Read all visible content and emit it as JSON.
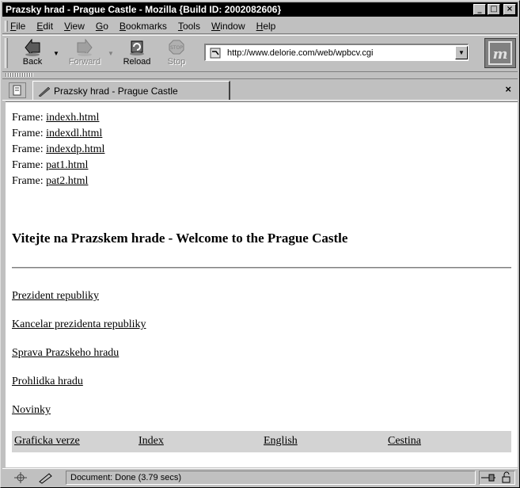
{
  "window": {
    "title": "Prazsky hrad - Prague Castle - Mozilla {Build ID: 2002082606}"
  },
  "menu": {
    "items": [
      {
        "label": "File",
        "mnemonic": "F",
        "rest": "ile"
      },
      {
        "label": "Edit",
        "mnemonic": "E",
        "rest": "dit"
      },
      {
        "label": "View",
        "mnemonic": "V",
        "rest": "iew"
      },
      {
        "label": "Go",
        "mnemonic": "G",
        "rest": "o"
      },
      {
        "label": "Bookmarks",
        "mnemonic": "B",
        "rest": "ookmarks"
      },
      {
        "label": "Tools",
        "mnemonic": "T",
        "rest": "ools"
      },
      {
        "label": "Window",
        "mnemonic": "W",
        "rest": "indow"
      },
      {
        "label": "Help",
        "mnemonic": "H",
        "rest": "elp"
      }
    ]
  },
  "toolbar": {
    "back_label": "Back",
    "forward_label": "Forward",
    "reload_label": "Reload",
    "stop_label": "Stop",
    "url": "http://www.delorie.com/web/wpbcv.cgi"
  },
  "tabs": [
    {
      "label": "Prazsky hrad - Prague Castle"
    }
  ],
  "page": {
    "frames_prefix": "Frame:",
    "frames": [
      "indexh.html",
      "indexdl.html",
      "indexdp.html",
      "pat1.html",
      "pat2.html"
    ],
    "heading": "Vitejte na Prazskem hrade - Welcome to the Prague Castle",
    "links": [
      "Prezident republiky",
      "Kancelar prezidenta republiky",
      "Sprava Prazskeho hradu",
      "Prohlidka hradu",
      "Novinky"
    ],
    "bottom_links": [
      "Graficka verze",
      "Index",
      "English",
      "Cestina"
    ]
  },
  "status": {
    "text": "Document: Done (3.79 secs)"
  },
  "colors": {
    "chrome": "#c0c0c0",
    "titlebar": "#000000",
    "content_bg": "#ffffff",
    "bottom_bar": "#d3d3d3"
  }
}
